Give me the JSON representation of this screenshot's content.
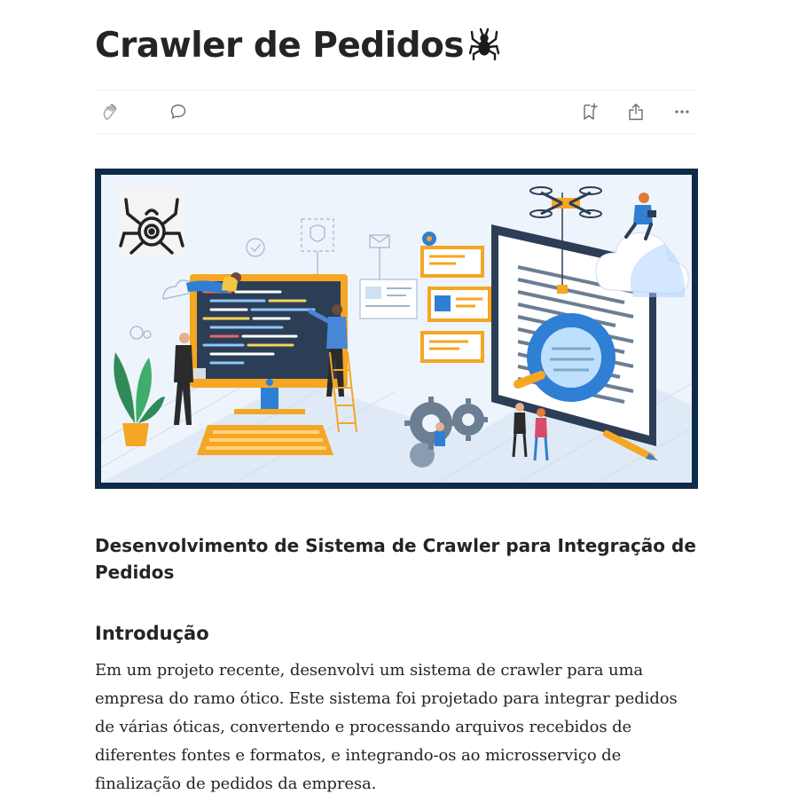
{
  "article": {
    "title": "Crawler de Pedidos",
    "title_emoji": "spider-icon",
    "subtitle": "Desenvolvimento de Sistema de Crawler para Integração de Pedidos",
    "section_heading": "Introdução",
    "paragraph": "Em um projeto recente, desenvolvi um sistema de crawler para uma empresa do ramo ótico. Este sistema foi projetado para integrar pedidos de várias óticas, convertendo e processando arquivos recebidos de diferentes fontes e formatos, e integrando-os ao microsserviço de finalização de pedidos da empresa."
  },
  "actions": {
    "clap": "clap-icon",
    "comment": "comment-icon",
    "save": "bookmark-add-icon",
    "share": "share-icon",
    "more": "more-icon"
  },
  "colors": {
    "text": "#242424",
    "icon": "#6b6b6b",
    "hero_frame": "#0f2b4a",
    "accent_orange": "#f5a623",
    "accent_blue": "#2f7fd4"
  }
}
